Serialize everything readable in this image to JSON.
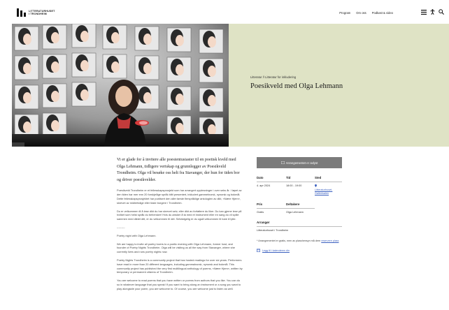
{
  "header": {
    "logo_line1": "LITTERATURHUSET",
    "logo_line2": "I TRONDHEIM",
    "nav": [
      "Program",
      "Om oss",
      "Podkast & video"
    ],
    "icons": [
      "menu-icon",
      "accessibility-icon",
      "search-icon"
    ]
  },
  "hero": {
    "category": "Litteratur // Litteratur for inkludering",
    "title": "Poesikveld med Olga Lehmann",
    "bg_color": "#dfe3c5"
  },
  "body": {
    "lead": "Vi er glade for å invitere alle poesientusiaster til en poetisk kveld med Olga Lehmann, tidligere vertskap og grunnlegger av Poesikveld Trondheim. Olga vil besøke oss helt fra Stavanger, der hun for tiden bor og driver poesikvelder.",
    "p1": "Poesikveld Trondheim er et fellesskapsprosjekt som har arrangert opplesninger i over seks år. I løpet av den tiden har mer enn 20 forskjellige språk blitt presentert, inkludert gammelnorsk, nynorsk og bokmål. Dette fellesskapsprosjektet har publisert den aller første flerspråklige antologien av dikt, «Nære Hjem», skrevet av midlertidige eller faste borgere i Trondheim.",
    "p2": "Du er velkommen til å lese dikt du har skrevet selv, eller dikt av forfattere du liker. Du kan gjerne lese på hvilket som helst språk du behersker! Hvis du ønsker å ta med et instrument eller en sang du vil spille sammen med diktet ditt, er du velkommen til det. Selvfølgelig er du også velkommen til bare å lytte.",
    "divider": "---------",
    "p3": "Poetry night with Olga Lehmann.",
    "p4": "We are happy to invite all poetry lovers to a poetic evening with Olga Lehmann, former host, and founder of Poetry Nights Trondheim. Olga will be visiting us all the way from Stavanger, where she currently lives and runs poetry nights now.",
    "p5": "Poetry Nights Trondheim is a community project that has hosted readings for over six years. Performers have read in more than 20 different languages, including gammalnorsk, nynorsk and bokmål. This community project has published the very first multilingual anthology of poems, «Nære Hjem», written by temporary or permanent citizens of Trondheim.",
    "p6": "You are welcome to read poems that you have written or poems from authors that you like. You can do so in whatever language that you speak! If you want to bring along an instrument or a song you want to play alongside your poem, you are welcome to. Of course, you are welcome just to listen as well."
  },
  "sidebar": {
    "ticket_label": "Arrangementet er avlyst",
    "date_h": "Dato",
    "date_v": "4. apr 2024",
    "time_h": "Tid",
    "time_v": "18:00 - 19:00",
    "place_h": "Sted",
    "place_v": "Litteraturhuset, Gallerisalen",
    "price_h": "Pris",
    "price_v": "Gratis",
    "part_h": "Deltakere",
    "part_v": "Olga Lehmann",
    "org_h": "Arrangør",
    "org_v": "Litteraturhuset i Trondheim",
    "note_prefix": "* Arrangementet er gratis, men av plasshensyn må dere",
    "note_link": "reservere plass",
    "cal_label": "Legg til i kalenderen din"
  }
}
